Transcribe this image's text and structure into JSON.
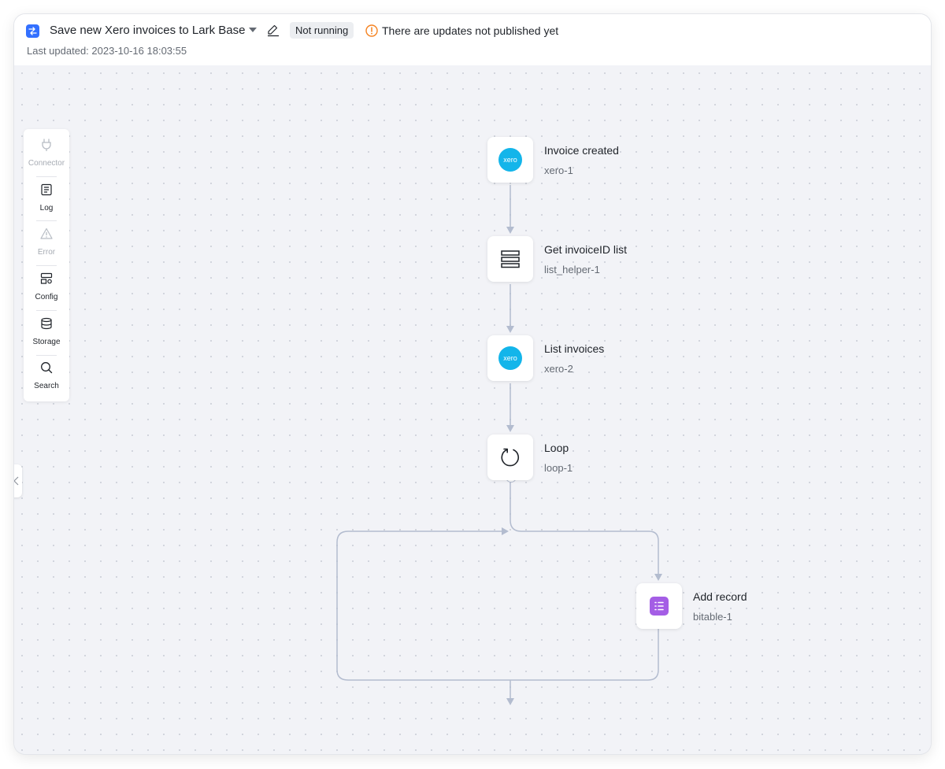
{
  "header": {
    "title": "Save new Xero invoices to Lark Base",
    "status": "Not running",
    "warning": "There are updates not published yet",
    "last_updated": "Last updated: 2023-10-16 18:03:55"
  },
  "toolbar": {
    "items": [
      {
        "label": "Connector",
        "icon": "plug-icon",
        "enabled": false
      },
      {
        "label": "Log",
        "icon": "log-icon",
        "enabled": true
      },
      {
        "label": "Error",
        "icon": "warning-icon",
        "enabled": false
      },
      {
        "label": "Config",
        "icon": "config-icon",
        "enabled": true
      },
      {
        "label": "Storage",
        "icon": "database-icon",
        "enabled": true
      },
      {
        "label": "Search",
        "icon": "search-icon",
        "enabled": true
      }
    ]
  },
  "nodes": [
    {
      "title": "Invoice created",
      "id": "xero-1",
      "icon": "xero-logo-icon",
      "logo_text": "xero"
    },
    {
      "title": "Get invoiceID list",
      "id": "list_helper-1",
      "icon": "list-icon"
    },
    {
      "title": "List invoices",
      "id": "xero-2",
      "icon": "xero-logo-icon",
      "logo_text": "xero"
    },
    {
      "title": "Loop",
      "id": "loop-1",
      "icon": "loop-icon"
    },
    {
      "title": "Add record",
      "id": "bitable-1",
      "icon": "bitable-icon"
    }
  ],
  "colors": {
    "accent": "#3370ff",
    "xero": "#13b5ea",
    "bitable": "#a45ee5",
    "warning": "#f5821f",
    "connector": "#b3bccf"
  }
}
